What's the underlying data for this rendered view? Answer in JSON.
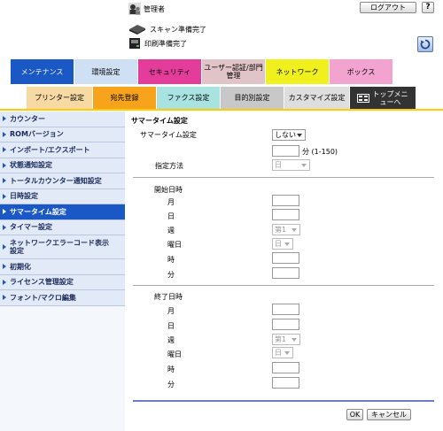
{
  "header": {
    "user_label": "管理者",
    "logout_label": "ログアウト",
    "help_label": "?",
    "status": [
      {
        "text": "スキャン準備完了",
        "icon": "scanner-icon"
      },
      {
        "text": "印刷準備完了",
        "icon": "printer-icon"
      }
    ]
  },
  "tabs_top": [
    {
      "label": "メンテナンス",
      "color": "#1a58c6",
      "active": true
    },
    {
      "label": "環境設定",
      "color": "#cfe0f5"
    },
    {
      "label": "セキュリティ",
      "color": "#e43c9b"
    },
    {
      "label": "ユーザー認証/部門管理",
      "color": "#e1c4c7"
    },
    {
      "label": "ネットワーク",
      "color": "#f0f01e"
    },
    {
      "label": "ボックス",
      "color": "#f2a3cf"
    }
  ],
  "tabs_sub": [
    {
      "label": "プリンター設定",
      "color": "#f7d9a3"
    },
    {
      "label": "宛先登録",
      "color": "#f7a31b"
    },
    {
      "label": "ファクス設定",
      "color": "#a8e3e1"
    },
    {
      "label": "目的別設定",
      "color": "#c8c8c8"
    },
    {
      "label": "カスタマイズ設定",
      "color": "#dedede"
    },
    {
      "label": "トップメニューへ",
      "color": "#333333"
    }
  ],
  "sidebar": {
    "items": [
      {
        "label": "カウンター"
      },
      {
        "label": "ROMバージョン"
      },
      {
        "label": "インポート/エクスポート"
      },
      {
        "label": "状態通知設定"
      },
      {
        "label": "トータルカウンター通知設定"
      },
      {
        "label": "日時設定"
      },
      {
        "label": "サマータイム設定",
        "active": true
      },
      {
        "label": "タイマー設定"
      },
      {
        "label": "ネットワークエラーコード表示設定"
      },
      {
        "label": "初期化"
      },
      {
        "label": "ライセンス管理設定"
      },
      {
        "label": "フォント/マクロ編集"
      }
    ]
  },
  "form": {
    "title": "サマータイム設定",
    "summer_time_label": "サマータイム設定",
    "summer_time_value": "しない",
    "minutes_unit": "分 (1-150)",
    "method_label": "指定方法",
    "method_value": "日",
    "start": {
      "title": "開始日時",
      "month": "月",
      "day": "日",
      "week": "週",
      "week_value": "第1",
      "weekday": "曜日",
      "weekday_value": "日",
      "hour": "時",
      "minute": "分"
    },
    "end": {
      "title": "終了日時",
      "month": "月",
      "day": "日",
      "week": "週",
      "week_value": "第1",
      "weekday": "曜日",
      "weekday_value": "日",
      "hour": "時",
      "minute": "分"
    },
    "ok_label": "OK",
    "cancel_label": "キャンセル"
  }
}
